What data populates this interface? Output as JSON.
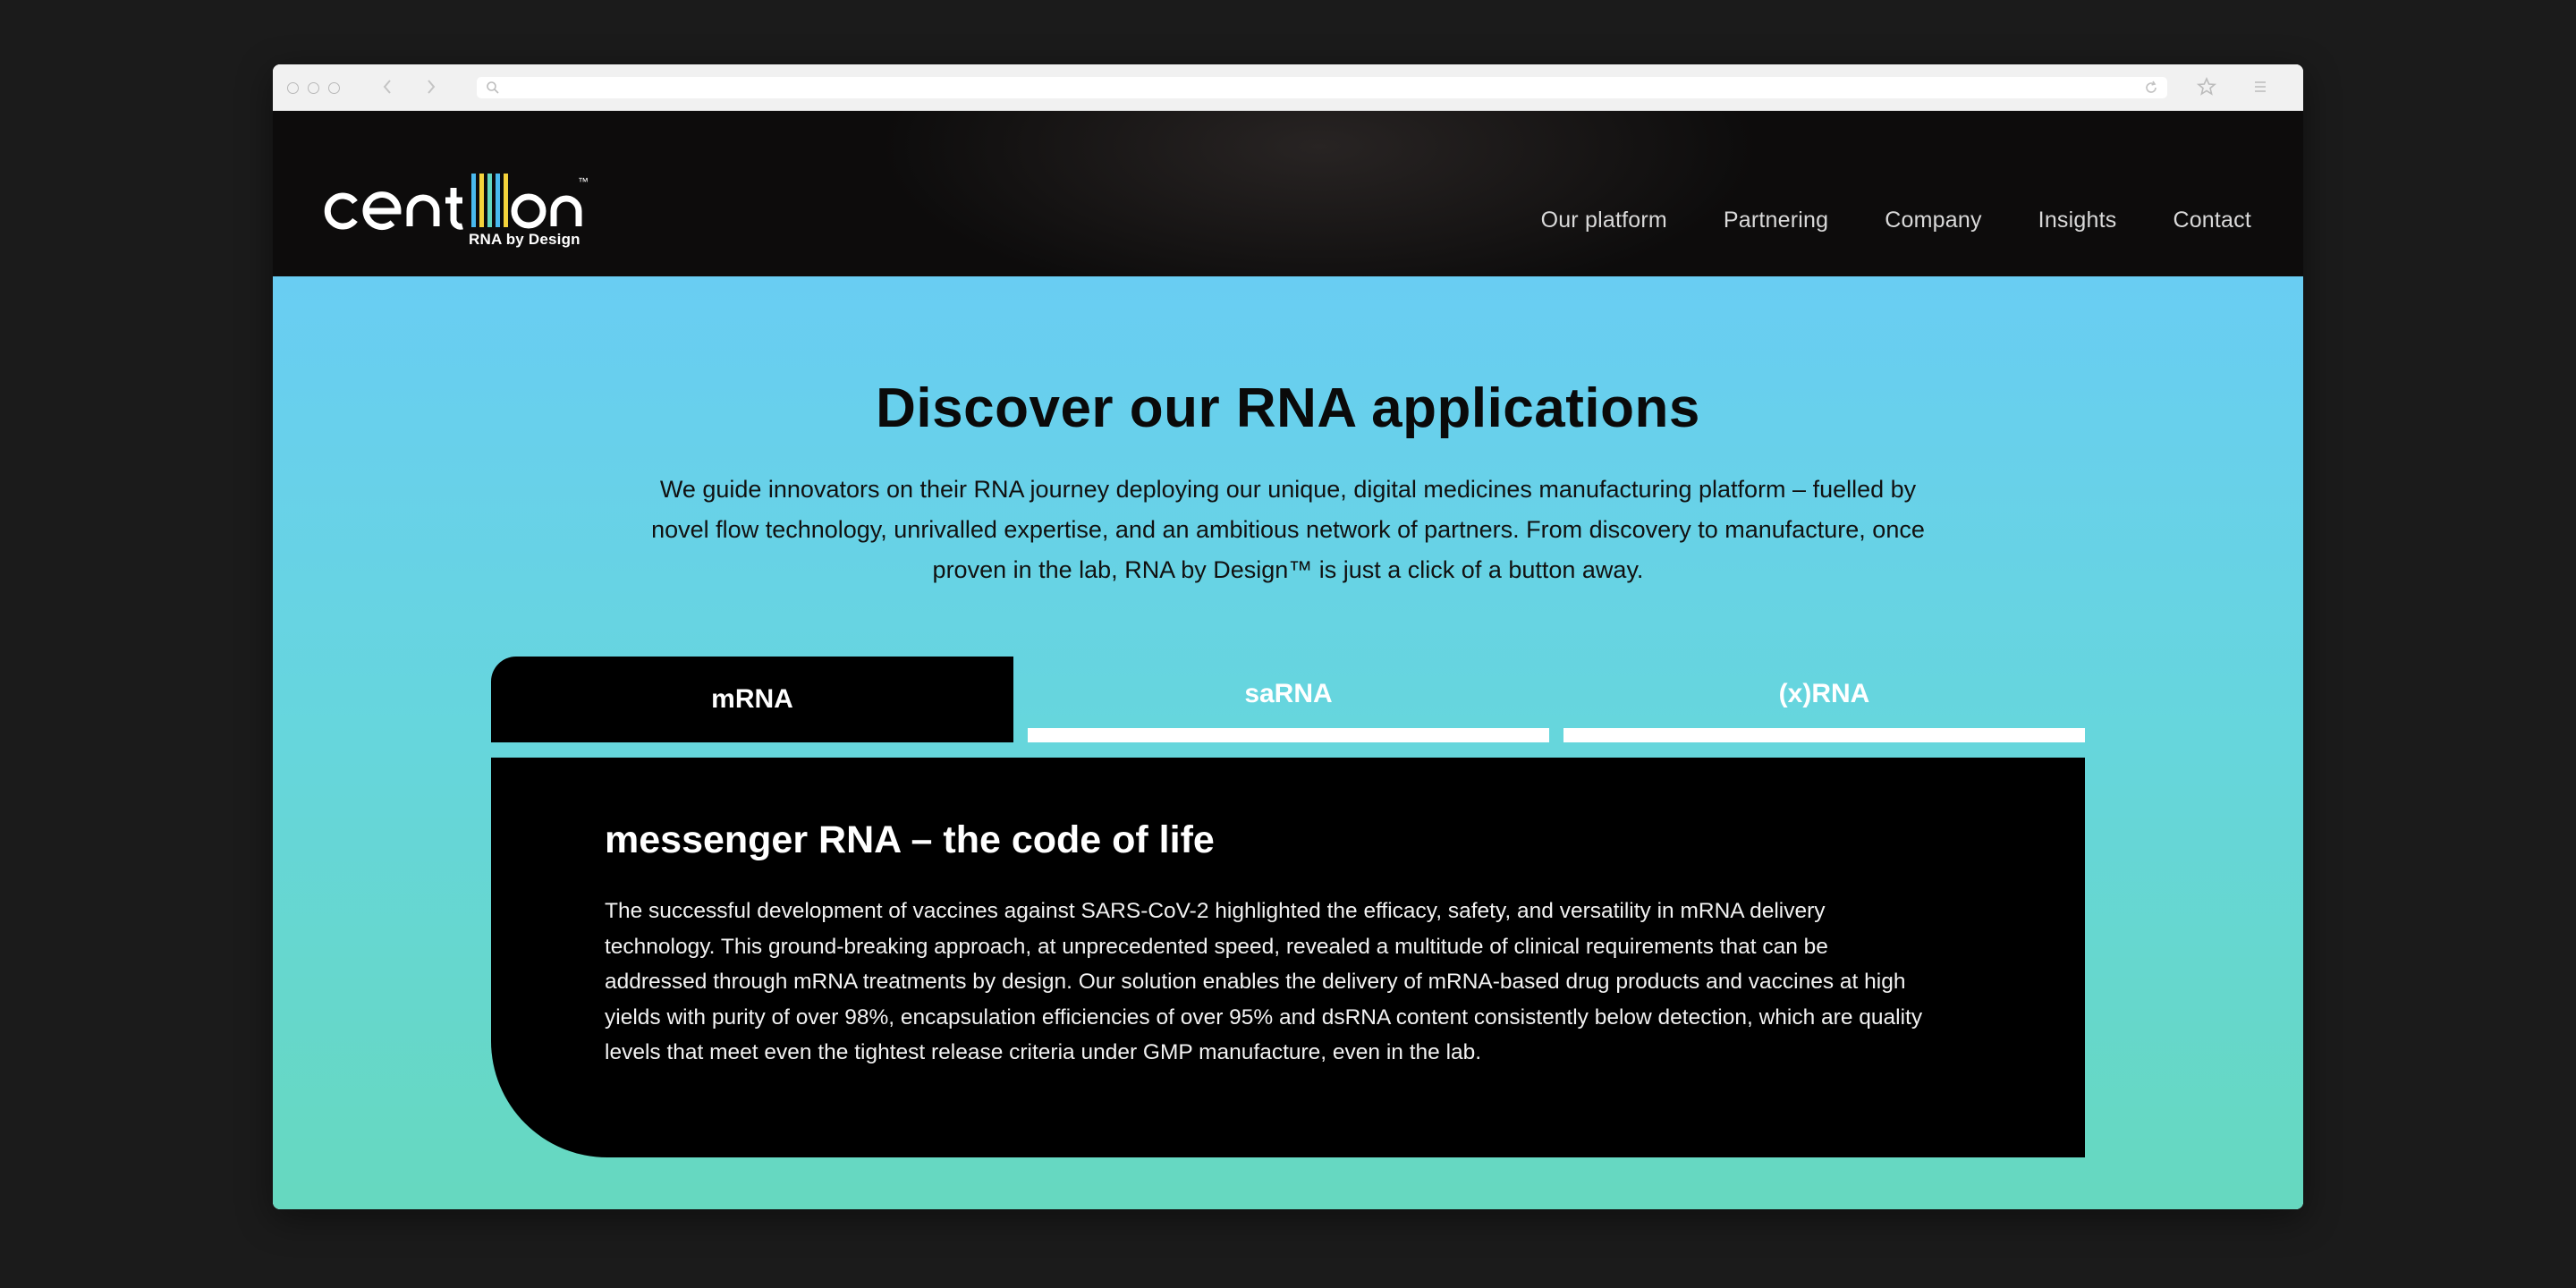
{
  "browser": {
    "address_value": ""
  },
  "header": {
    "logo_text": "centillion",
    "logo_trademark": "™",
    "logo_tagline": "RNA by Design",
    "nav": [
      {
        "label": "Our platform"
      },
      {
        "label": "Partnering"
      },
      {
        "label": "Company"
      },
      {
        "label": "Insights"
      },
      {
        "label": "Contact"
      }
    ]
  },
  "hero": {
    "title": "Discover our RNA applications",
    "text": "We guide innovators on their RNA journey deploying our unique, digital medicines manufacturing platform – fuelled by novel flow technology, unrivalled expertise, and an ambitious network of partners. From discovery to manufacture, once proven in the lab, RNA by Design™ is just a click of a button away."
  },
  "tabs": [
    {
      "label": "mRNA",
      "active": true
    },
    {
      "label": "saRNA",
      "active": false
    },
    {
      "label": "(x)RNA",
      "active": false
    }
  ],
  "panel": {
    "title": "messenger RNA – the code of life",
    "text": "The successful development of vaccines against SARS-CoV-2 highlighted the efficacy, safety, and versatility in mRNA delivery technology. This ground-breaking approach, at unprecedented speed, revealed a multitude of clinical requirements that can be addressed through mRNA treatments by design. Our solution enables the delivery of mRNA-based drug products and vaccines at high yields with purity of over 98%, encapsulation efficiencies of over 95% and dsRNA content consistently below detection, which are quality levels that meet even the tightest release criteria under GMP manufacture, even in the lab."
  },
  "colors": {
    "page_bg": "#1b1b1b",
    "header_bg": "#0d0c0c",
    "gradient_top": "#69cdf3",
    "gradient_bottom": "#66d8bf",
    "panel_bg": "#000000",
    "logo_bar_blue": "#49b9ee",
    "logo_bar_yellow": "#f5d33b",
    "logo_bar_teal": "#62d6c0"
  },
  "icons": [
    "search-icon",
    "reload-icon",
    "star-icon",
    "menu-icon",
    "back-arrow-icon",
    "forward-arrow-icon"
  ]
}
